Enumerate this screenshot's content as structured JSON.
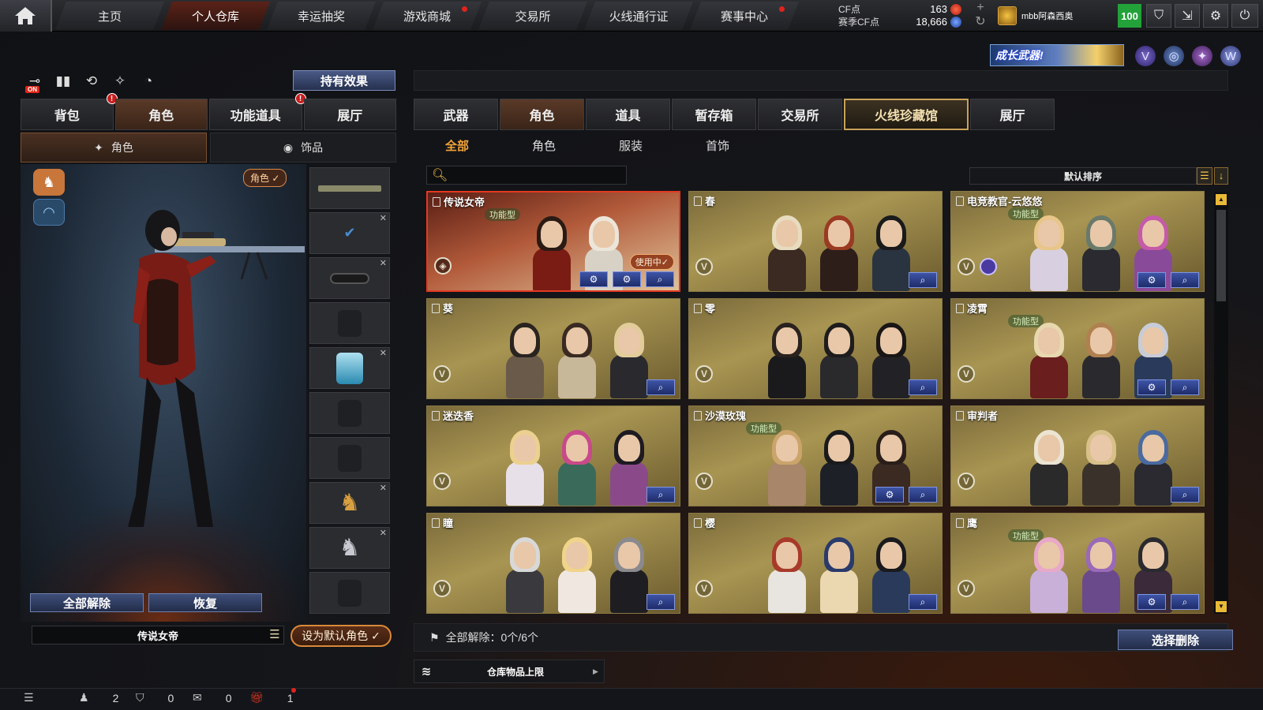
{
  "topbar": {
    "nav": [
      {
        "label": "主页",
        "active": false,
        "dot": false
      },
      {
        "label": "个人仓库",
        "active": true,
        "dot": false
      },
      {
        "label": "幸运抽奖",
        "active": false,
        "dot": false
      },
      {
        "label": "游戏商城",
        "active": false,
        "dot": true
      },
      {
        "label": "交易所",
        "active": false,
        "dot": false
      },
      {
        "label": "火线通行证",
        "active": false,
        "dot": false
      },
      {
        "label": "赛事中心",
        "active": false,
        "dot": true
      }
    ],
    "cf_label": "CF点",
    "cf_value": "163",
    "season_cf_label": "赛季CF点",
    "season_cf_value": "18,666",
    "username": "mbb阿森西奥",
    "level": "100",
    "icons": [
      "shield-icon",
      "exit-icon",
      "gear-icon",
      "power-icon"
    ]
  },
  "banner": {
    "growth_weapon": "成长武器!",
    "icons": [
      "v-badge-icon",
      "globe-icon",
      "gear-badge-icon",
      "w-badge-icon"
    ]
  },
  "left": {
    "tool_on_label": "ON",
    "hold_effect": "持有效果",
    "tabs": [
      {
        "label": "背包",
        "active": false,
        "alert": true
      },
      {
        "label": "角色",
        "active": true,
        "alert": false
      },
      {
        "label": "功能道具",
        "active": false,
        "alert": true
      },
      {
        "label": "展厅",
        "active": false,
        "alert": false
      }
    ],
    "subtabs": [
      {
        "label": "角色",
        "icon": "sparkle-person-icon",
        "active": true
      },
      {
        "label": "饰品",
        "icon": "ornament-icon",
        "active": false
      }
    ],
    "role_chip": "角色 ✓",
    "unequip_all": "全部解除",
    "restore": "恢复",
    "current_name": "传说女帝",
    "set_default": "设为默认角色 ✓"
  },
  "right": {
    "main_tabs": [
      {
        "label": "武器",
        "style": "normal"
      },
      {
        "label": "角色",
        "style": "active"
      },
      {
        "label": "道具",
        "style": "normal"
      },
      {
        "label": "暂存箱",
        "style": "normal"
      },
      {
        "label": "交易所",
        "style": "normal"
      },
      {
        "label": "火线珍藏馆",
        "style": "gold"
      },
      {
        "label": "展厅",
        "style": "normal"
      }
    ],
    "sub_tabs": [
      {
        "label": "全部",
        "active": true
      },
      {
        "label": "角色",
        "active": false
      },
      {
        "label": "服装",
        "active": false
      },
      {
        "label": "首饰",
        "active": false
      }
    ],
    "search_placeholder": "",
    "sort_label": "默认排序",
    "cards": [
      {
        "name": "传说女帝",
        "func": "功能型",
        "inuse": true,
        "inuse_label": "使用中✓",
        "btns": [
          "⚙",
          "⚙",
          "🔍"
        ],
        "v": false,
        "purple": false,
        "figs": [
          [
            "#2a1a14",
            "#7a1c14"
          ],
          [
            "#ece6da",
            "#d8d2c6"
          ]
        ]
      },
      {
        "name": "春",
        "func": "",
        "inuse": false,
        "btns": [
          "🔍"
        ],
        "v": true,
        "purple": false,
        "figs": [
          [
            "#e8dcc0",
            "#3a2a22"
          ],
          [
            "#9a3a22",
            "#2e1e1a"
          ],
          [
            "#1a1a1c",
            "#2a3440"
          ]
        ]
      },
      {
        "name": "电竞教官-云悠悠",
        "func": "功能型",
        "inuse": false,
        "btns": [
          "⚙",
          "🔍"
        ],
        "v": true,
        "purple": true,
        "figs": [
          [
            "#e8c68a",
            "#d8d0e0"
          ],
          [
            "#6a7a6a",
            "#2a2a30"
          ],
          [
            "#c45aa8",
            "#8a4a9a"
          ]
        ]
      },
      {
        "name": "葵",
        "func": "",
        "inuse": false,
        "btns": [
          "🔍"
        ],
        "v": true,
        "purple": false,
        "figs": [
          [
            "#2a2420",
            "#6a5a4a"
          ],
          [
            "#3a2a22",
            "#c8b89a"
          ],
          [
            "#e2cc9a",
            "#2a2a2e"
          ]
        ]
      },
      {
        "name": "零",
        "func": "",
        "inuse": false,
        "btns": [
          "🔍"
        ],
        "v": true,
        "purple": false,
        "figs": [
          [
            "#2a221e",
            "#1a1a1c"
          ],
          [
            "#1e1c1c",
            "#2a2a2c"
          ],
          [
            "#1a1616",
            "#222226"
          ]
        ]
      },
      {
        "name": "凌霄",
        "func": "功能型",
        "inuse": false,
        "btns": [
          "⚙",
          "🔍"
        ],
        "v": true,
        "purple": false,
        "figs": [
          [
            "#e8d8b0",
            "#6a1e1e"
          ],
          [
            "#b08050",
            "#2a2a2e"
          ],
          [
            "#c8ccd8",
            "#2a3a5a"
          ]
        ]
      },
      {
        "name": "迷迭香",
        "func": "",
        "inuse": false,
        "btns": [
          "🔍"
        ],
        "v": true,
        "purple": false,
        "figs": [
          [
            "#ecd090",
            "#e8e0e8"
          ],
          [
            "#c84a8a",
            "#3a6a5a"
          ],
          [
            "#1e1a22",
            "#8a4a8a"
          ]
        ]
      },
      {
        "name": "沙漠玫瑰",
        "func": "功能型",
        "inuse": false,
        "btns": [
          "⚙",
          "🔍"
        ],
        "v": true,
        "purple": false,
        "figs": [
          [
            "#caa46a",
            "#a8866a"
          ],
          [
            "#1a1a1c",
            "#1e2028"
          ],
          [
            "#2a1e1a",
            "#3a2a22"
          ]
        ]
      },
      {
        "name": "审判者",
        "func": "",
        "inuse": false,
        "btns": [
          "🔍"
        ],
        "v": true,
        "purple": false,
        "figs": [
          [
            "#ece4d2",
            "#2a2a2a"
          ],
          [
            "#d8c08a",
            "#3a322a"
          ],
          [
            "#4a6aa0",
            "#2a2a30"
          ]
        ]
      },
      {
        "name": "瞳",
        "func": "",
        "inuse": false,
        "btns": [
          "🔍"
        ],
        "v": true,
        "purple": false,
        "figs": [
          [
            "#d8d8d8",
            "#3a3a3e"
          ],
          [
            "#f0d48a",
            "#f0e8e0"
          ],
          [
            "#8a8a8e",
            "#1e1e22"
          ]
        ]
      },
      {
        "name": "樱",
        "func": "",
        "inuse": false,
        "btns": [
          "🔍"
        ],
        "v": true,
        "purple": false,
        "figs": [
          [
            "#a83a2a",
            "#e8e4e0"
          ],
          [
            "#2a3a6a",
            "#ecd8b0"
          ],
          [
            "#1a1a1e",
            "#2a3a5a"
          ]
        ]
      },
      {
        "name": "鹰",
        "func": "功能型",
        "inuse": false,
        "btns": [
          "⚙",
          "🔍"
        ],
        "v": true,
        "purple": false,
        "figs": [
          [
            "#e8a8c8",
            "#c8b0d8"
          ],
          [
            "#9a6ab8",
            "#6a4a8a"
          ],
          [
            "#2a2a2e",
            "#3a2a3a"
          ]
        ]
      }
    ],
    "footer_label": "全部解除：0个/6个",
    "select_delete": "选择删除",
    "capacity_label": "仓库物品上限"
  },
  "statusbar": {
    "a": "2",
    "b": "0",
    "c": "0",
    "d": "1"
  }
}
